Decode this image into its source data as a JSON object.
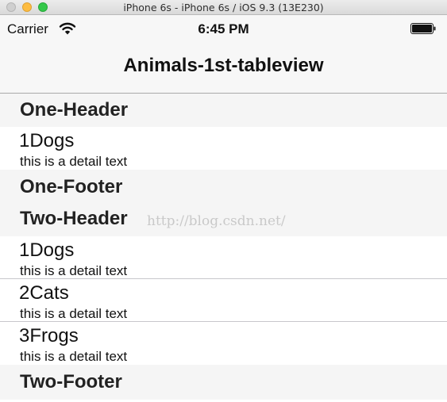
{
  "window": {
    "title": "iPhone 6s - iPhone 6s / iOS 9.3 (13E230)"
  },
  "status_bar": {
    "carrier": "Carrier",
    "time": "6:45 PM",
    "wifi_icon": "wifi-icon",
    "battery_icon": "battery-icon"
  },
  "nav": {
    "title": "Animals-1st-tableview"
  },
  "sections": [
    {
      "header": "One-Header",
      "rows": [
        {
          "title": "1Dogs",
          "detail": "this is a detail text"
        }
      ],
      "footer": "One-Footer"
    },
    {
      "header": "Two-Header",
      "rows": [
        {
          "title": "1Dogs",
          "detail": "this is a detail text"
        },
        {
          "title": "2Cats",
          "detail": "this is a detail text"
        },
        {
          "title": "3Frogs",
          "detail": "this is a detail text"
        }
      ],
      "footer": "Two-Footer"
    }
  ],
  "watermark": "http://blog.csdn.net/"
}
